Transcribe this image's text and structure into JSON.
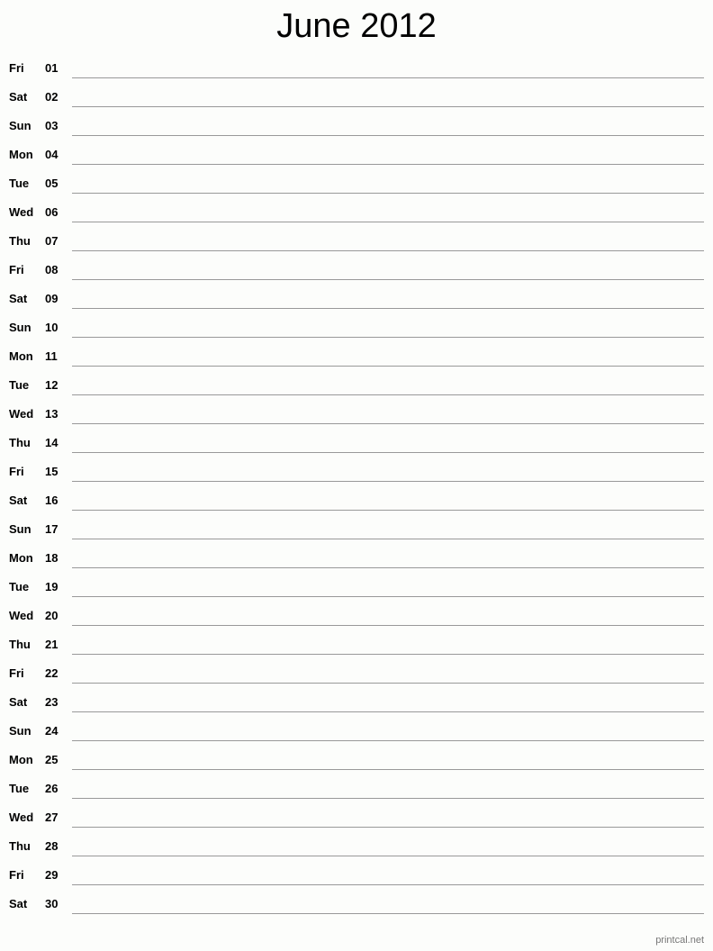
{
  "title": "June 2012",
  "days": [
    {
      "day": "Fri",
      "date": "01"
    },
    {
      "day": "Sat",
      "date": "02"
    },
    {
      "day": "Sun",
      "date": "03"
    },
    {
      "day": "Mon",
      "date": "04"
    },
    {
      "day": "Tue",
      "date": "05"
    },
    {
      "day": "Wed",
      "date": "06"
    },
    {
      "day": "Thu",
      "date": "07"
    },
    {
      "day": "Fri",
      "date": "08"
    },
    {
      "day": "Sat",
      "date": "09"
    },
    {
      "day": "Sun",
      "date": "10"
    },
    {
      "day": "Mon",
      "date": "11"
    },
    {
      "day": "Tue",
      "date": "12"
    },
    {
      "day": "Wed",
      "date": "13"
    },
    {
      "day": "Thu",
      "date": "14"
    },
    {
      "day": "Fri",
      "date": "15"
    },
    {
      "day": "Sat",
      "date": "16"
    },
    {
      "day": "Sun",
      "date": "17"
    },
    {
      "day": "Mon",
      "date": "18"
    },
    {
      "day": "Tue",
      "date": "19"
    },
    {
      "day": "Wed",
      "date": "20"
    },
    {
      "day": "Thu",
      "date": "21"
    },
    {
      "day": "Fri",
      "date": "22"
    },
    {
      "day": "Sat",
      "date": "23"
    },
    {
      "day": "Sun",
      "date": "24"
    },
    {
      "day": "Mon",
      "date": "25"
    },
    {
      "day": "Tue",
      "date": "26"
    },
    {
      "day": "Wed",
      "date": "27"
    },
    {
      "day": "Thu",
      "date": "28"
    },
    {
      "day": "Fri",
      "date": "29"
    },
    {
      "day": "Sat",
      "date": "30"
    }
  ],
  "footer": "printcal.net"
}
